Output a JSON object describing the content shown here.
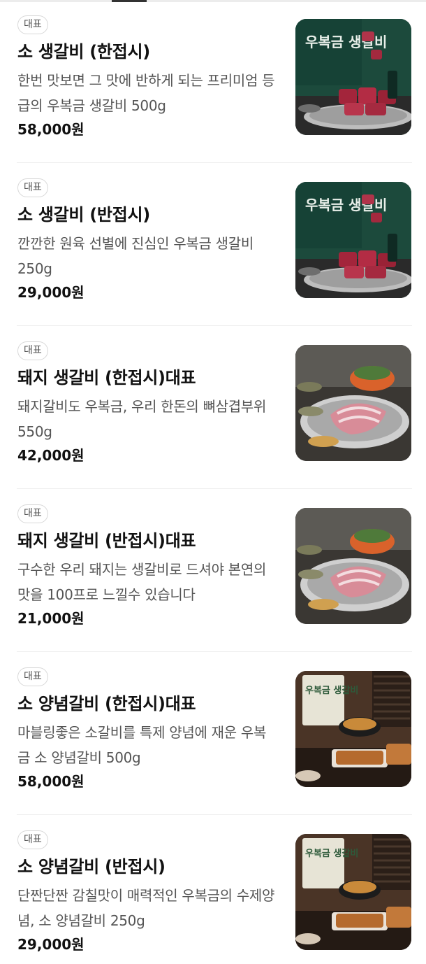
{
  "menu_items": [
    {
      "badge": "대표",
      "name": "소 생갈비 (한접시)",
      "description": "한번 맛보면 그 맛에 반하게 되는 프리미엄 등급의 우복금 생갈비 500g",
      "price": "58,000원",
      "image_text": "우복금 생갈비",
      "image_icon": "beef-photo-icon"
    },
    {
      "badge": "대표",
      "name": "소 생갈비 (반접시)",
      "description": "깐깐한 원육 선별에 진심인 우복금 생갈비 250g",
      "price": "29,000원",
      "image_text": "우복금 생갈비",
      "image_icon": "beef-photo-icon"
    },
    {
      "badge": "대표",
      "name": "돼지 생갈비 (한접시)대표",
      "description": "돼지갈비도 우복금, 우리 한돈의 뼈삼겹부위 550g",
      "price": "42,000원",
      "image_text": "",
      "image_icon": "pork-photo-icon"
    },
    {
      "badge": "대표",
      "name": "돼지 생갈비 (반접시)대표",
      "description": "구수한 우리 돼지는 생갈비로 드셔야 본연의 맛을 100프로 느낄수 있습니다",
      "price": "21,000원",
      "image_text": "",
      "image_icon": "pork-photo-icon"
    },
    {
      "badge": "대표",
      "name": "소 양념갈비 (한접시)대표",
      "description": "마블링좋은 소갈비를 특제 양념에 재운 우복금 소 양념갈비 500g",
      "price": "58,000원",
      "image_text": "우복금 생갈비",
      "image_icon": "marinated-beef-photo-icon"
    },
    {
      "badge": "대표",
      "name": "소 양념갈비 (반접시)",
      "description": "단짠단짠 감칠맛이 매력적인 우복금의 수제양념, 소 양념갈비 250g",
      "price": "29,000원",
      "image_text": "우복금 생갈비",
      "image_icon": "marinated-beef-photo-icon"
    }
  ],
  "colors": {
    "badge_border": "#d8d8d8",
    "name_text": "#111111",
    "desc_text": "#555555",
    "divider": "#efefef"
  }
}
